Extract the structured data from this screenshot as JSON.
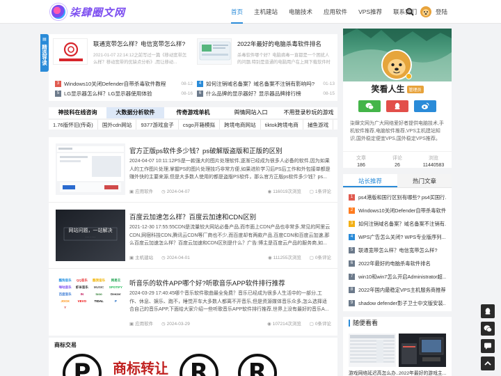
{
  "header": {
    "logo_text": "柒肆圈文网",
    "nav": [
      "首页",
      "主机建站",
      "电脑技术",
      "应用软件",
      "VPS推荐",
      "联系我们"
    ],
    "login": "登陆"
  },
  "side_tab": {
    "label": "精选导读"
  },
  "featured": [
    {
      "title": "联通宽带怎么样？电信宽带怎么样?",
      "desc": "2021-01-07 22:14:12之前写过一篇《移动宽带怎么样？移动宽带的优缺点分析》,而让移动..."
    },
    {
      "title": "2022年最好的电脑杀毒软件排名",
      "desc": "杀毒软件哪个好？电脑病毒一直都是一个困扰人的问题,特别是普通的电脑用户在上网下载软件时候..."
    }
  ],
  "hot_list": [
    {
      "num": "3",
      "title": "Windows10关闭Defender自带杀毒软件教程",
      "date": "08-12"
    },
    {
      "num": "4",
      "title": "如何注销域名备案？域名备案不注销有影响吗?",
      "date": "01-13"
    },
    {
      "num": "5",
      "title": "LG显示器怎么样？LG显示器使用体验",
      "date": "08-16"
    },
    {
      "num": "6",
      "title": "什么品牌的显示器好？显示器品牌排行榜",
      "date": "08-15"
    }
  ],
  "category_tabs": [
    "神技科在线咨询",
    "大数据分析软件",
    "传奇游戏单机",
    "舆情网站入口",
    "不用登录秒玩的游戏"
  ],
  "links": [
    "1.76版怀旧(传奇)",
    "国外cdn网站",
    "9377游戏盒子",
    "csgo开箱模拟",
    "跨境电商网站",
    "tiktok跨境电商",
    "捕鱼游戏"
  ],
  "articles": [
    {
      "title": "官方正版ps软件多少钱？ps破解版盗版和正版的区别",
      "desc": "2024-04-07 10:11:12PS是一款强大的图片处理软件,逐渐已经成为很多人必备的软件,因为如果人的工作图片处理,掌握PS的图片处理技巧非常方便,如果进阶学习后PS后工作和外包接单都是赚外快的主要来源,但是大多数人使用的都是盗版PS软件，那么官方正版ps软件多少钱？ps...",
      "category": "应用软件",
      "date": "2024-04-07",
      "views": "116019次浏览",
      "comments": "1条评论"
    },
    {
      "title": "百度云加速怎么样？百度云加速和CDN区别",
      "desc": "2021-12-30 17:55:55CDN是流量较大网站必备产品,而市面上CDN产品也非常多,常见的阿里云CDN,网宿科技CDN,腾讯云CDN等厂商也不少,而百度却有两款产品,百度CDN和百度云加速,那么百度云加速怎么样？百度云加速和CDN区别是什么？广告:博主是百度云产品的服务商,如...",
      "category": "主机建站",
      "date": "2024-04-01",
      "views": "111255次浏览",
      "comments": "0条评论"
    },
    {
      "title": "听音乐的软件APP哪个好?听歌音乐APP软件排行推荐",
      "desc": "2024-03-29 17:40:45哪个音乐软件歌曲最全免费？音乐已经成为很多人生活中的一部分,工作、休息、娱乐、跑不，睡觉开车大多数人都离不开音乐,但是资源媒体音乐众多,怎么选择适合自己的音乐APP,下面给大家介绍一些听歌音乐APP软件排行推荐,世界上没有最好的音乐A...",
      "category": "应用软件",
      "date": "2024-03-29",
      "views": "107214次浏览",
      "comments": "0条评论"
    }
  ],
  "article_thumb2_text": [
    "网站问题 · 一站解决",
    "网站问题，一站解决"
  ],
  "music_logos": [
    "酷狗音乐",
    "QQ音乐",
    "酷我音乐",
    "网易云",
    "咪咕音乐",
    "虾米音乐",
    "MUSIC",
    "SPOTIFY",
    "百度音乐",
    "IN",
    "Ixoo",
    "Deezer",
    "JOOX",
    "VEVO",
    "TIDAL",
    "P",
    "Y"
  ],
  "brand": {
    "title": "商标交易",
    "images_text": [
      "®",
      "商标转让",
      "®"
    ]
  },
  "profile": {
    "name": "笑看人生",
    "badge": "管理员",
    "desc": "柒肆文网为广大网络爱好者提供电脑技术,手机软件推荐,电脑软件推荐,VPS主机建站知识,国外稳定便宜VPS,国外稳定VPS推荐。",
    "stats": [
      {
        "label": "文章",
        "value": "186"
      },
      {
        "label": "评论",
        "value": "26"
      },
      {
        "label": "浏览",
        "value": "11440583"
      }
    ]
  },
  "recommend": {
    "tabs": [
      "站长推荐",
      "热门文章"
    ],
    "items": [
      {
        "num": "1",
        "title": "ps4港版和国行区别有哪些? ps4买国行..."
      },
      {
        "num": "2",
        "title": "Windows10关闭Defender自带杀毒软件教程"
      },
      {
        "num": "3",
        "title": "如何注销域名备案？域名备案不注销有..."
      },
      {
        "num": "4",
        "title": "WPS广告怎么关闭? WPS专业版序列..."
      },
      {
        "num": "5",
        "title": "联通宽带怎么样？电信宽带怎么样?"
      },
      {
        "num": "6",
        "title": "2022年最好的电脑杀毒软件排名"
      },
      {
        "num": "7",
        "title": "win10和win7怎么开启Administrator超..."
      },
      {
        "num": "8",
        "title": "2022年国内最稳定VPS主机服务商推荐"
      },
      {
        "num": "9",
        "title": "shadow defender影子卫士中文版安装..."
      }
    ]
  },
  "random": {
    "title": "随便看看",
    "items": [
      "游戏网络延迟高怎么办...",
      "2022年最好的游戏主..."
    ]
  },
  "colors": {
    "accent": "#2a8bd8",
    "num_colors": [
      "#e05a4f",
      "#ff7c1f",
      "#f3b015",
      "#2a8bd8",
      "#6c7a8b"
    ],
    "wechat": "#44b549",
    "qq": "#e24f4a",
    "weibo": "#2a8bd8"
  }
}
